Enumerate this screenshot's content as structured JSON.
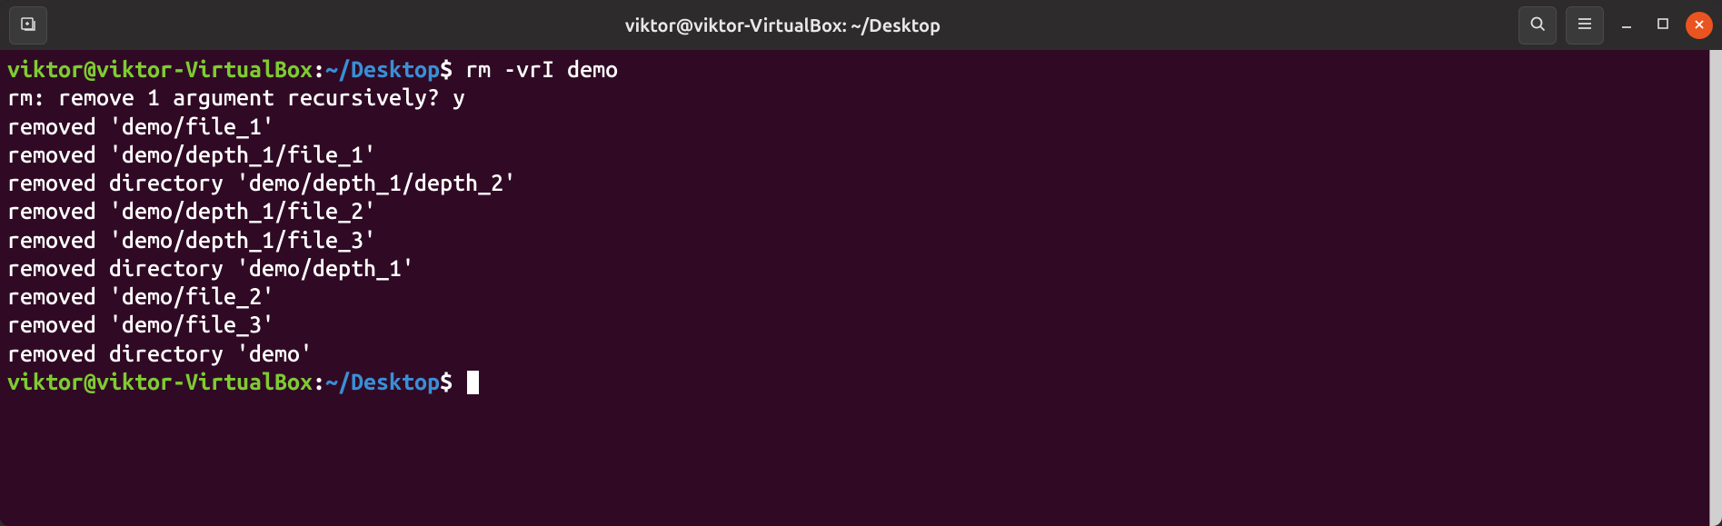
{
  "titlebar": {
    "title": "viktor@viktor-VirtualBox: ~/Desktop"
  },
  "prompt": {
    "user_host": "viktor@viktor-VirtualBox",
    "colon": ":",
    "path": "~/Desktop",
    "symbol": "$"
  },
  "session": {
    "command": " rm -vrI demo",
    "output_lines": [
      "rm: remove 1 argument recursively? y",
      "removed 'demo/file_1'",
      "removed 'demo/depth_1/file_1'",
      "removed directory 'demo/depth_1/depth_2'",
      "removed 'demo/depth_1/file_2'",
      "removed 'demo/depth_1/file_3'",
      "removed directory 'demo/depth_1'",
      "removed 'demo/file_2'",
      "removed 'demo/file_3'",
      "removed directory 'demo'"
    ]
  },
  "icons": {
    "new_tab": "new-tab-icon",
    "search": "search-icon",
    "menu": "menu-icon",
    "minimize": "minimize-icon",
    "maximize": "maximize-icon",
    "close": "close-icon"
  }
}
